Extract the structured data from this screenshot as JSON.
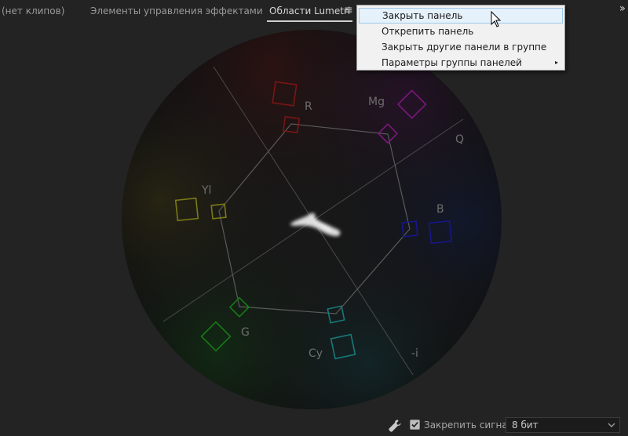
{
  "tabs": [
    {
      "label": "(нет клипов)",
      "active": false
    },
    {
      "label": "Элементы управления эффектами",
      "active": false
    },
    {
      "label": "Области Lumetri",
      "active": true
    }
  ],
  "tab_menu_icon": "hamburger-menu-icon",
  "overflow_icon": "double-chevron-right-icon",
  "context_menu": {
    "items": [
      {
        "label": "Закрыть панель",
        "hover": true
      },
      {
        "label": "Открепить панель"
      },
      {
        "label": "Закрыть другие панели в группе"
      },
      {
        "label": "Параметры группы панелей",
        "submenu": true
      }
    ],
    "submenu_arrow": "▸"
  },
  "vectorscope": {
    "targets": {
      "R": "R",
      "Mg": "Mg",
      "B": "B",
      "Cy": "Cy",
      "G": "G",
      "Yl": "Yl"
    },
    "axes": {
      "Q": "Q",
      "I": "-i"
    },
    "colors": {
      "R": "#8a1616",
      "Mg": "#8a1a8a",
      "B": "#18188e",
      "Cy": "#168a8a",
      "G": "#168a16",
      "Yl": "#8a8a16"
    }
  },
  "footer": {
    "wrench_icon": "wrench-icon",
    "lock_signal_checked": true,
    "lock_signal_label": "Закрепить сигнал",
    "bit_depth": "8 бит"
  },
  "colors": {
    "panel_bg": "#232323",
    "menu_bg": "#f1f1f1",
    "menu_hover": "#e5f1fb"
  }
}
